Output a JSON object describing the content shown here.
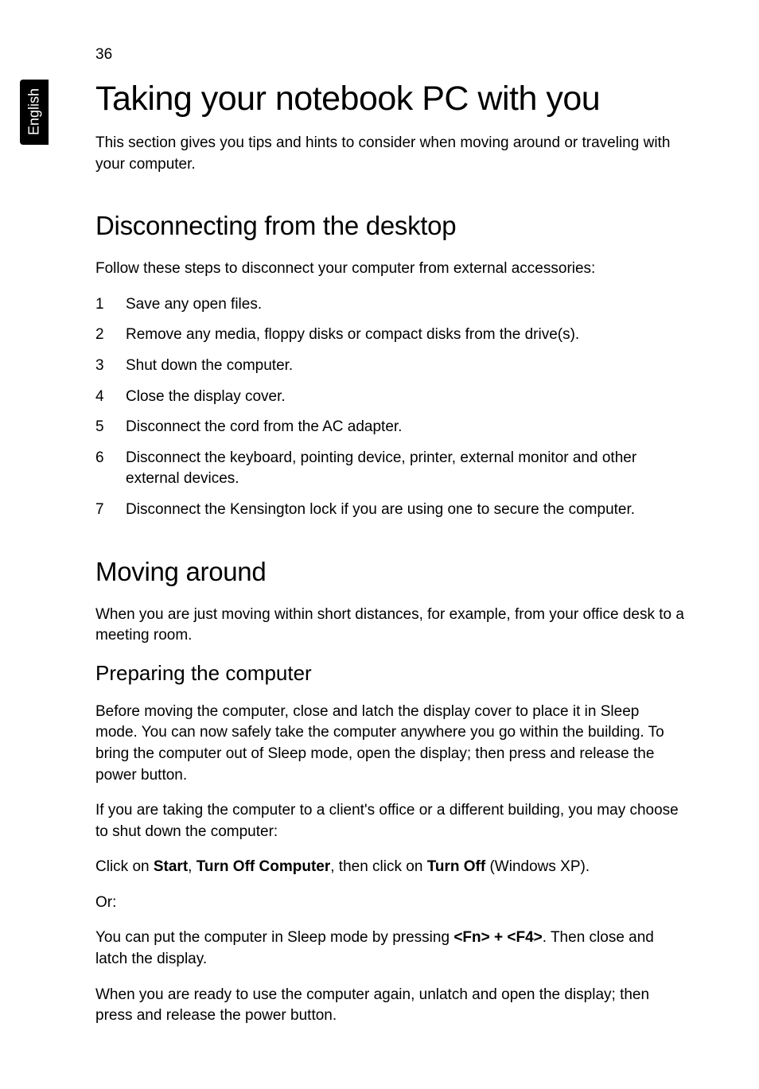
{
  "page_number": "36",
  "language_tab": "English",
  "heading1": "Taking your notebook PC with you",
  "intro": "This section gives you tips and hints to consider when moving around or traveling with your computer.",
  "section1": {
    "heading": "Disconnecting from the desktop",
    "intro": "Follow these steps to disconnect your computer from external accessories:",
    "steps": [
      "Save any open files.",
      "Remove any media, floppy disks or compact disks from the drive(s).",
      "Shut down the computer.",
      "Close the display cover.",
      "Disconnect the cord from the AC adapter.",
      "Disconnect the keyboard, pointing device, printer, external monitor and other external devices.",
      "Disconnect the Kensington lock if you are using one to secure the computer."
    ]
  },
  "section2": {
    "heading": "Moving around",
    "intro": "When you are just moving within short distances, for example, from your office desk to a meeting room.",
    "subheading": "Preparing the computer",
    "p1": "Before moving the computer, close and latch the display cover to place it in Sleep mode. You can now safely take the computer anywhere you go within the building. To bring the computer out of Sleep mode, open the display; then press and release the power button.",
    "p2": "If you are taking the computer to a client's office or a different building, you may choose to shut down the computer:",
    "p3_pre": "Click on ",
    "p3_b1": "Start",
    "p3_mid1": ", ",
    "p3_b2": "Turn Off Computer",
    "p3_mid2": ", then click on ",
    "p3_b3": "Turn Off",
    "p3_post": " (Windows XP).",
    "p4": "Or:",
    "p5_pre": "You can put the computer in Sleep mode by pressing ",
    "p5_b1": "<Fn> + <F4>",
    "p5_post": ". Then close and latch the display.",
    "p6": "When you are ready to use the computer again, unlatch and open the display; then press and release the power button."
  }
}
